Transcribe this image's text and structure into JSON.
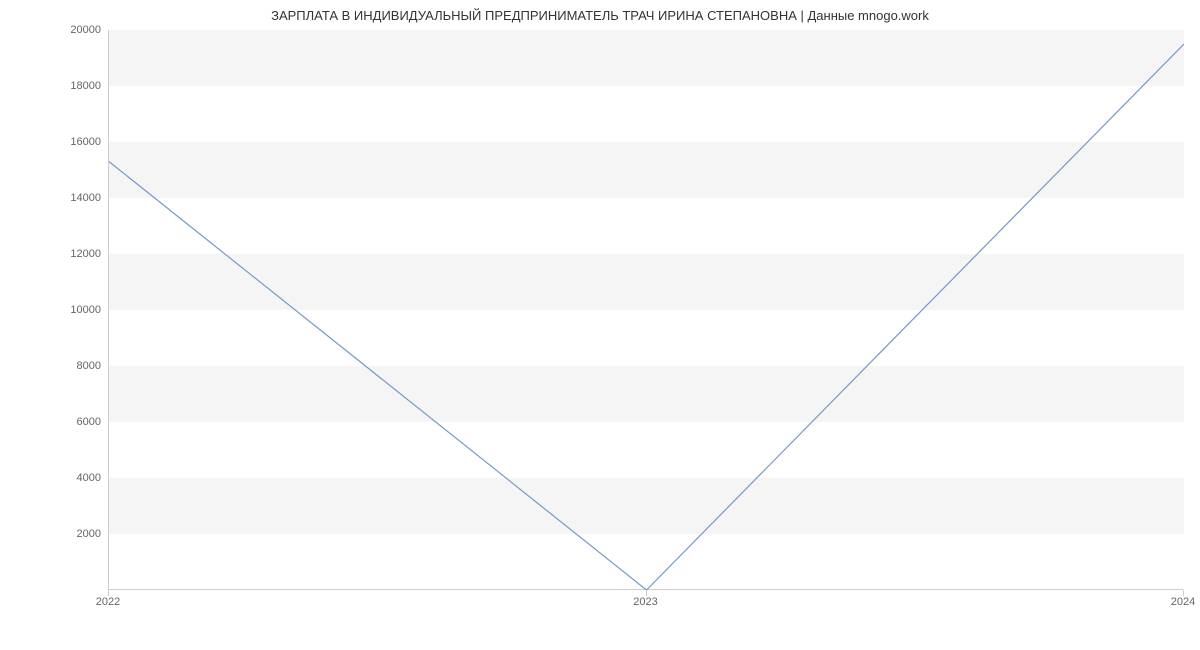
{
  "chart_data": {
    "type": "line",
    "title": "ЗАРПЛАТА В ИНДИВИДУАЛЬНЫЙ ПРЕДПРИНИМАТЕЛЬ ТРАЧ ИРИНА СТЕПАНОВНА | Данные mnogo.work",
    "xlabel": "",
    "ylabel": "",
    "x": [
      2022,
      2023,
      2024
    ],
    "values": [
      15300,
      0,
      19500
    ],
    "x_ticks": [
      "2022",
      "2023",
      "2024"
    ],
    "y_ticks": [
      2000,
      4000,
      6000,
      8000,
      10000,
      12000,
      14000,
      16000,
      18000,
      20000
    ],
    "ylim": [
      0,
      20000
    ],
    "xlim": [
      2022,
      2024
    ],
    "grid": true,
    "line_color": "#7698c9"
  }
}
